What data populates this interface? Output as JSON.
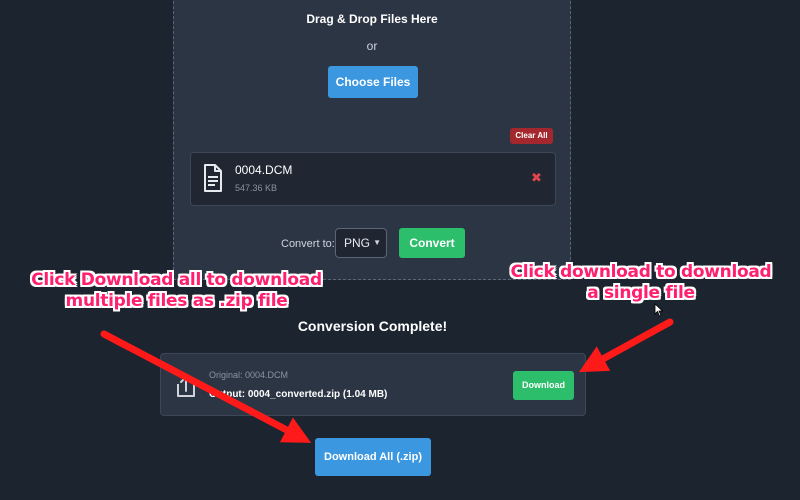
{
  "upload": {
    "drag_text": "Drag & Drop Files Here",
    "or_text": "or",
    "choose_label": "Choose Files",
    "clear_label": "Clear All"
  },
  "files": [
    {
      "name": "0004.DCM",
      "size": "547.36 KB"
    }
  ],
  "convert": {
    "label": "Convert to:",
    "format": "PNG",
    "button_label": "Convert"
  },
  "result": {
    "title": "Conversion Complete!",
    "original": "Original: 0004.DCM",
    "output": "Output: 0004_converted.zip (1.04 MB)",
    "download_label": "Download",
    "download_all_label": "Download All (.zip)"
  },
  "annotations": {
    "left_line1": "Click Download all to download",
    "left_line2": "multiple files as .zip file",
    "right_line1": "Click download to download",
    "right_line2": "a single file"
  },
  "colors": {
    "background": "#1c2430",
    "panel": "#2c3544",
    "primary_blue": "#3a97e0",
    "success_green": "#2dbe6c",
    "danger_red": "#a3272c",
    "annotation_pink": "#ff1f6e",
    "arrow_red": "#ff1a1a"
  },
  "icons": {
    "file": "file-document-icon",
    "remove": "close-icon",
    "result": "upload-arrow-icon",
    "select": "chevron-down-icon"
  }
}
